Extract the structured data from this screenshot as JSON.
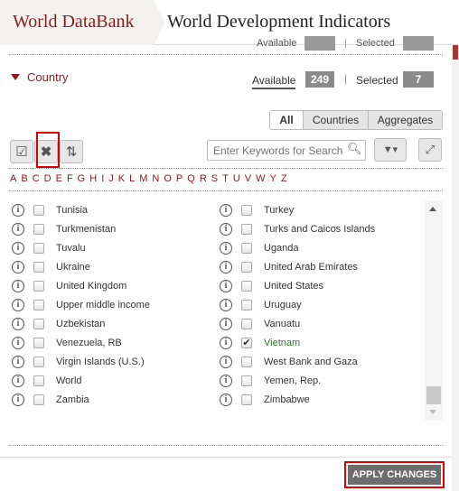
{
  "header": {
    "brand": "World DataBank",
    "title": "World Development Indicators"
  },
  "previous_section": {
    "available_label": "Available",
    "selected_label": "Selected"
  },
  "country": {
    "title": "Country",
    "available_label": "Available",
    "available_count": "249",
    "selected_label": "Selected",
    "selected_count": "7"
  },
  "filters": [
    "All",
    "Countries",
    "Aggregates"
  ],
  "search": {
    "placeholder": "Enter Keywords for Search"
  },
  "alphabet": [
    "A",
    "B",
    "C",
    "D",
    "E",
    "F",
    "G",
    "H",
    "I",
    "J",
    "K",
    "L",
    "M",
    "N",
    "O",
    "P",
    "Q",
    "R",
    "S",
    "T",
    "U",
    "V",
    "W",
    "Y",
    "Z"
  ],
  "list_left": [
    {
      "name": "Tunisia",
      "checked": false
    },
    {
      "name": "Turkmenistan",
      "checked": false
    },
    {
      "name": "Tuvalu",
      "checked": false
    },
    {
      "name": "Ukraine",
      "checked": false
    },
    {
      "name": "United Kingdom",
      "checked": false
    },
    {
      "name": "Upper middle income",
      "checked": false
    },
    {
      "name": "Uzbekistan",
      "checked": false
    },
    {
      "name": "Venezuela, RB",
      "checked": false
    },
    {
      "name": "Virgin Islands (U.S.)",
      "checked": false
    },
    {
      "name": "World",
      "checked": false
    },
    {
      "name": "Zambia",
      "checked": false
    }
  ],
  "list_right": [
    {
      "name": "Turkey",
      "checked": false
    },
    {
      "name": "Turks and Caicos Islands",
      "checked": false
    },
    {
      "name": "Uganda",
      "checked": false
    },
    {
      "name": "United Arab Emirates",
      "checked": false
    },
    {
      "name": "United States",
      "checked": false
    },
    {
      "name": "Uruguay",
      "checked": false
    },
    {
      "name": "Vanuatu",
      "checked": false
    },
    {
      "name": "Vietnam",
      "checked": true
    },
    {
      "name": "West Bank and Gaza",
      "checked": false
    },
    {
      "name": "Yemen, Rep.",
      "checked": false
    },
    {
      "name": "Zimbabwe",
      "checked": false
    }
  ],
  "footer": {
    "apply_label": "APPLY CHANGES"
  },
  "colors": {
    "brand": "#8b1a1a",
    "selected_item": "#2a7a2a",
    "highlight": "#dd0000"
  },
  "icons": [
    "select-all-icon",
    "clear-selection-icon",
    "sort-icon",
    "search-icon",
    "filter-icon",
    "expand-icon",
    "info-icon",
    "checkbox-icon"
  ]
}
